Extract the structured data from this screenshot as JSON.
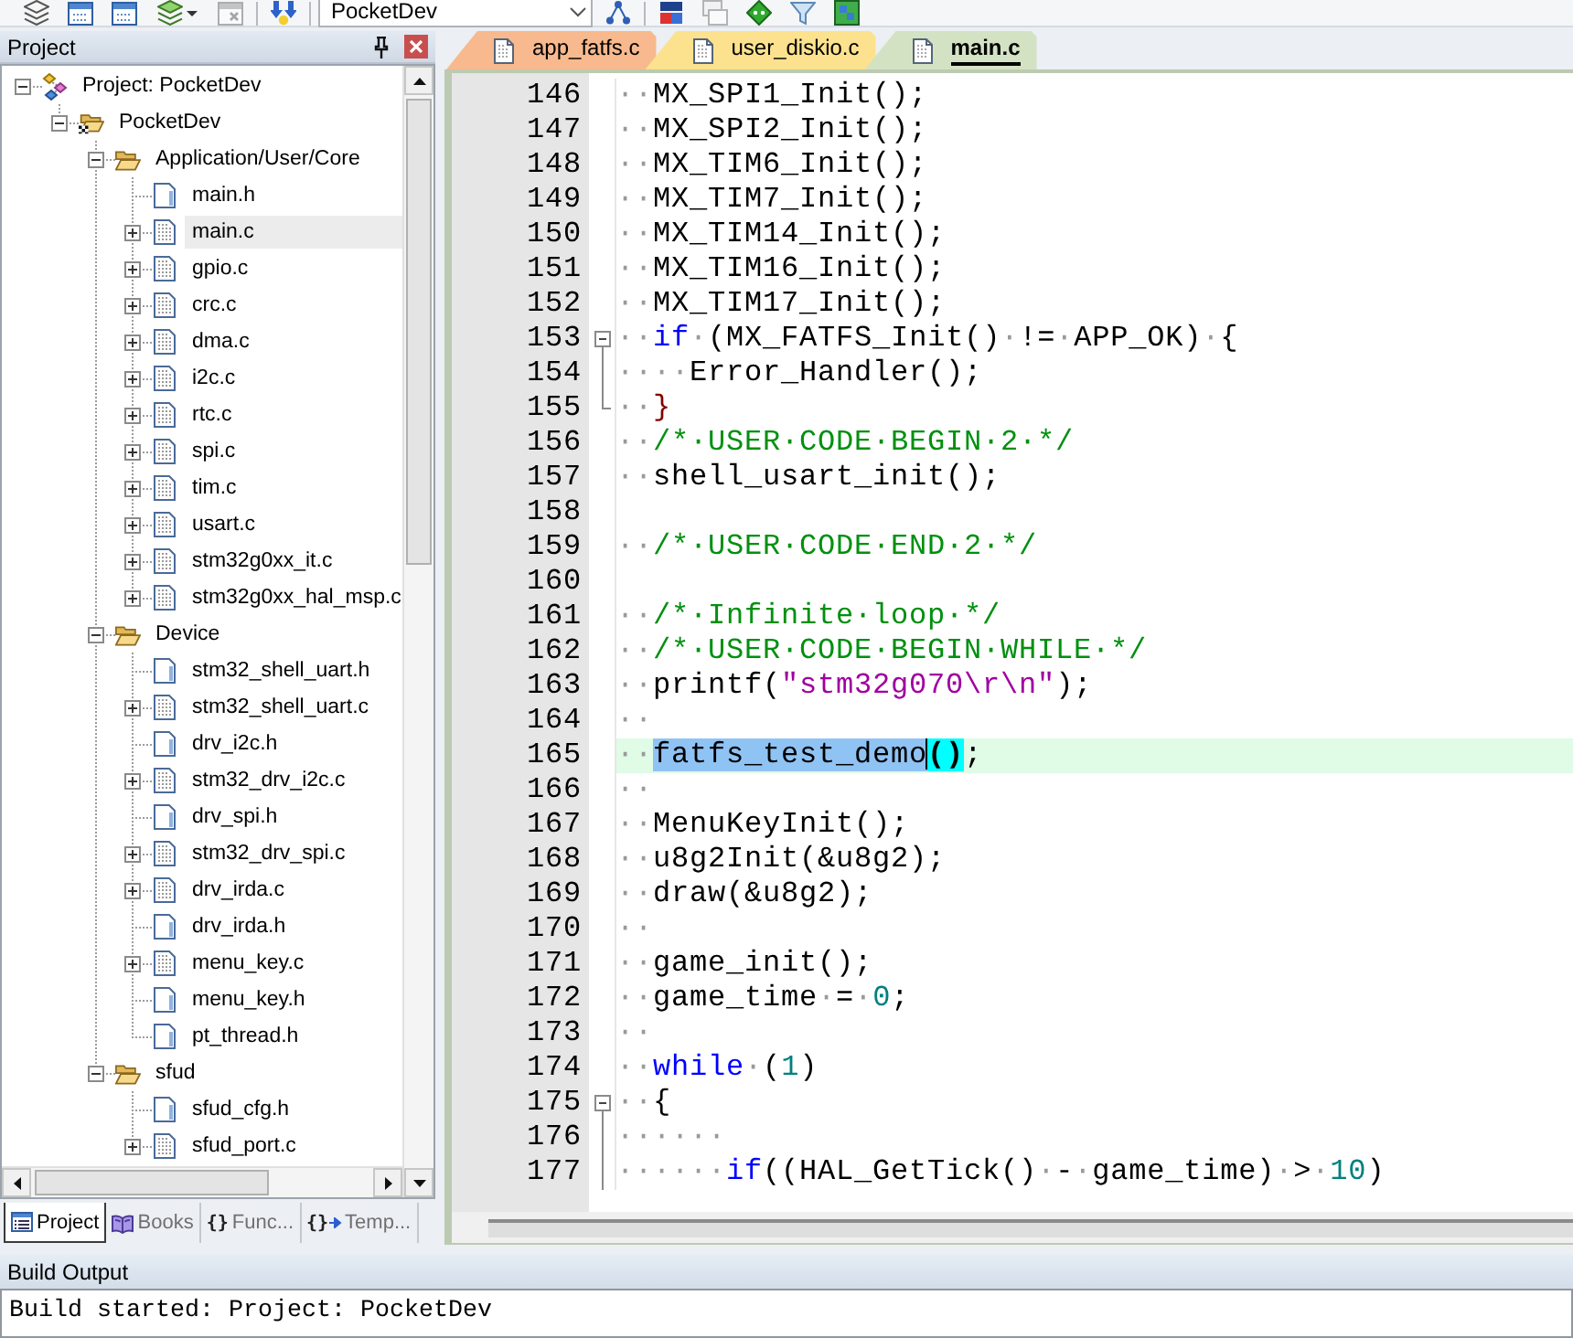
{
  "toolbar": {
    "items": [
      {
        "kind": "button",
        "disabled": false
      },
      {
        "kind": "button",
        "disabled": false
      },
      {
        "kind": "button",
        "disabled": false
      },
      {
        "kind": "dropdown_button",
        "disabled": false
      },
      {
        "kind": "button",
        "disabled": true
      },
      {
        "kind": "separator"
      },
      {
        "kind": "button",
        "disabled": false
      },
      {
        "kind": "separator"
      },
      {
        "kind": "select",
        "value": "PocketDev"
      },
      {
        "kind": "button",
        "disabled": false
      },
      {
        "kind": "separator"
      },
      {
        "kind": "button",
        "disabled": false
      },
      {
        "kind": "button",
        "disabled": true
      },
      {
        "kind": "button",
        "disabled": false
      },
      {
        "kind": "button",
        "disabled": false
      },
      {
        "kind": "button",
        "disabled": false
      }
    ]
  },
  "project_panel": {
    "title": "Project",
    "tree": [
      {
        "label": "Project: PocketDev",
        "kind": "project",
        "expanded": true,
        "selected": false,
        "children": [
          {
            "label": "PocketDev",
            "kind": "target",
            "expanded": true,
            "selected": false,
            "children": [
              {
                "label": "Application/User/Core",
                "kind": "group",
                "expanded": true,
                "selected": false,
                "children": [
                  {
                    "label": "main.h",
                    "kind": "header",
                    "selected": false
                  },
                  {
                    "label": "main.c",
                    "kind": "source",
                    "expanded": false,
                    "selected": true
                  },
                  {
                    "label": "gpio.c",
                    "kind": "source",
                    "expanded": false,
                    "selected": false
                  },
                  {
                    "label": "crc.c",
                    "kind": "source",
                    "expanded": false,
                    "selected": false
                  },
                  {
                    "label": "dma.c",
                    "kind": "source",
                    "expanded": false,
                    "selected": false
                  },
                  {
                    "label": "i2c.c",
                    "kind": "source",
                    "expanded": false,
                    "selected": false
                  },
                  {
                    "label": "rtc.c",
                    "kind": "source",
                    "expanded": false,
                    "selected": false
                  },
                  {
                    "label": "spi.c",
                    "kind": "source",
                    "expanded": false,
                    "selected": false
                  },
                  {
                    "label": "tim.c",
                    "kind": "source",
                    "expanded": false,
                    "selected": false
                  },
                  {
                    "label": "usart.c",
                    "kind": "source",
                    "expanded": false,
                    "selected": false
                  },
                  {
                    "label": "stm32g0xx_it.c",
                    "kind": "source",
                    "expanded": false,
                    "selected": false
                  },
                  {
                    "label": "stm32g0xx_hal_msp.c",
                    "kind": "source",
                    "expanded": false,
                    "selected": false
                  }
                ]
              },
              {
                "label": "Device",
                "kind": "group",
                "expanded": true,
                "selected": false,
                "children": [
                  {
                    "label": "stm32_shell_uart.h",
                    "kind": "header",
                    "selected": false
                  },
                  {
                    "label": "stm32_shell_uart.c",
                    "kind": "source",
                    "expanded": false,
                    "selected": false
                  },
                  {
                    "label": "drv_i2c.h",
                    "kind": "header",
                    "selected": false
                  },
                  {
                    "label": "stm32_drv_i2c.c",
                    "kind": "source",
                    "expanded": false,
                    "selected": false
                  },
                  {
                    "label": "drv_spi.h",
                    "kind": "header",
                    "selected": false
                  },
                  {
                    "label": "stm32_drv_spi.c",
                    "kind": "source",
                    "expanded": false,
                    "selected": false
                  },
                  {
                    "label": "drv_irda.c",
                    "kind": "source",
                    "expanded": false,
                    "selected": false
                  },
                  {
                    "label": "drv_irda.h",
                    "kind": "header",
                    "selected": false
                  },
                  {
                    "label": "menu_key.c",
                    "kind": "source",
                    "expanded": false,
                    "selected": false
                  },
                  {
                    "label": "menu_key.h",
                    "kind": "header",
                    "selected": false
                  },
                  {
                    "label": "pt_thread.h",
                    "kind": "header",
                    "selected": false
                  }
                ]
              },
              {
                "label": "sfud",
                "kind": "group",
                "expanded": true,
                "selected": false,
                "children": [
                  {
                    "label": "sfud_cfg.h",
                    "kind": "header",
                    "selected": false
                  },
                  {
                    "label": "sfud_port.c",
                    "kind": "source",
                    "expanded": false,
                    "selected": false
                  }
                ]
              }
            ]
          }
        ]
      }
    ],
    "tabs": [
      {
        "label": "Project",
        "kind": "project",
        "selected": true
      },
      {
        "label": "Books",
        "kind": "books",
        "selected": false
      },
      {
        "label": "Func...",
        "kind": "functions",
        "glyph": "{}",
        "selected": false
      },
      {
        "label": "Temp...",
        "kind": "templates",
        "glyph": "{}",
        "selected": false
      }
    ]
  },
  "editor": {
    "tabs": [
      {
        "label": "app_fatfs.c",
        "color": "#f7b98d",
        "selected": false
      },
      {
        "label": "user_diskio.c",
        "color": "#fce28e",
        "selected": false
      },
      {
        "label": "main.c",
        "color": "#d4e2c4",
        "selected": true
      }
    ],
    "code_lines": [
      {
        "number": "146",
        "kind": "line",
        "current": false,
        "segments": [
          {
            "kind": "ws",
            "text": "··"
          },
          {
            "kind": "plain",
            "text": "MX_SPI1_Init();"
          }
        ]
      },
      {
        "number": "147",
        "kind": "line",
        "current": false,
        "segments": [
          {
            "kind": "ws",
            "text": "··"
          },
          {
            "kind": "plain",
            "text": "MX_SPI2_Init();"
          }
        ]
      },
      {
        "number": "148",
        "kind": "line",
        "current": false,
        "segments": [
          {
            "kind": "ws",
            "text": "··"
          },
          {
            "kind": "plain",
            "text": "MX_TIM6_Init();"
          }
        ]
      },
      {
        "number": "149",
        "kind": "line",
        "current": false,
        "segments": [
          {
            "kind": "ws",
            "text": "··"
          },
          {
            "kind": "plain",
            "text": "MX_TIM7_Init();"
          }
        ]
      },
      {
        "number": "150",
        "kind": "line",
        "current": false,
        "segments": [
          {
            "kind": "ws",
            "text": "··"
          },
          {
            "kind": "plain",
            "text": "MX_TIM14_Init();"
          }
        ]
      },
      {
        "number": "151",
        "kind": "line",
        "current": false,
        "segments": [
          {
            "kind": "ws",
            "text": "··"
          },
          {
            "kind": "plain",
            "text": "MX_TIM16_Init();"
          }
        ]
      },
      {
        "number": "152",
        "kind": "line",
        "current": false,
        "segments": [
          {
            "kind": "ws",
            "text": "··"
          },
          {
            "kind": "plain",
            "text": "MX_TIM17_Init();"
          }
        ]
      },
      {
        "number": "153",
        "kind": "fold_start",
        "current": false,
        "segments": [
          {
            "kind": "ws",
            "text": "··"
          },
          {
            "kind": "keyword",
            "text": "if"
          },
          {
            "kind": "ws",
            "text": "·"
          },
          {
            "kind": "plain",
            "text": "(MX_FATFS_Init()"
          },
          {
            "kind": "ws",
            "text": "·"
          },
          {
            "kind": "plain",
            "text": "!="
          },
          {
            "kind": "ws",
            "text": "·"
          },
          {
            "kind": "plain",
            "text": "APP_OK)"
          },
          {
            "kind": "ws",
            "text": "·"
          },
          {
            "kind": "plain",
            "text": "{"
          }
        ]
      },
      {
        "number": "154",
        "kind": "fold_body",
        "current": false,
        "segments": [
          {
            "kind": "ws",
            "text": "····"
          },
          {
            "kind": "plain",
            "text": "Error_Handler();"
          }
        ]
      },
      {
        "number": "155",
        "kind": "fold_end",
        "current": false,
        "segments": [
          {
            "kind": "ws",
            "text": "··"
          },
          {
            "kind": "brace",
            "text": "}"
          }
        ]
      },
      {
        "number": "156",
        "kind": "line",
        "current": false,
        "segments": [
          {
            "kind": "ws",
            "text": "··"
          },
          {
            "kind": "comment",
            "text": "/*·USER·CODE·BEGIN·2·*/"
          }
        ]
      },
      {
        "number": "157",
        "kind": "line",
        "current": false,
        "segments": [
          {
            "kind": "ws",
            "text": "··"
          },
          {
            "kind": "plain",
            "text": "shell_usart_init();"
          }
        ]
      },
      {
        "number": "158",
        "kind": "line",
        "current": false
      },
      {
        "number": "159",
        "kind": "line",
        "current": false,
        "segments": [
          {
            "kind": "ws",
            "text": "··"
          },
          {
            "kind": "comment",
            "text": "/*·USER·CODE·END·2·*/"
          }
        ]
      },
      {
        "number": "160",
        "kind": "line",
        "current": false
      },
      {
        "number": "161",
        "kind": "line",
        "current": false,
        "segments": [
          {
            "kind": "ws",
            "text": "··"
          },
          {
            "kind": "comment",
            "text": "/*·Infinite·loop·*/"
          }
        ]
      },
      {
        "number": "162",
        "kind": "line",
        "current": false,
        "segments": [
          {
            "kind": "ws",
            "text": "··"
          },
          {
            "kind": "comment",
            "text": "/*·USER·CODE·BEGIN·WHILE·*/"
          }
        ]
      },
      {
        "number": "163",
        "kind": "line",
        "current": false,
        "segments": [
          {
            "kind": "ws",
            "text": "··"
          },
          {
            "kind": "plain",
            "text": "printf("
          },
          {
            "kind": "string",
            "text": "\"stm32g070\\r\\n\""
          },
          {
            "kind": "plain",
            "text": ");"
          }
        ]
      },
      {
        "number": "164",
        "kind": "line",
        "current": false,
        "segments": [
          {
            "kind": "ws",
            "text": "··"
          }
        ]
      },
      {
        "number": "165",
        "kind": "line",
        "current": true,
        "segments": [
          {
            "kind": "ws",
            "text": "··"
          },
          {
            "kind": "selection",
            "text": "fatfs_test_demo",
            "caret": true
          },
          {
            "kind": "brace_match",
            "text": "()"
          },
          {
            "kind": "plain",
            "text": ";"
          }
        ]
      },
      {
        "number": "166",
        "kind": "line",
        "current": false,
        "segments": [
          {
            "kind": "ws",
            "text": "··"
          }
        ]
      },
      {
        "number": "167",
        "kind": "line",
        "current": false,
        "segments": [
          {
            "kind": "ws",
            "text": "··"
          },
          {
            "kind": "plain",
            "text": "MenuKeyInit();"
          }
        ]
      },
      {
        "number": "168",
        "kind": "line",
        "current": false,
        "segments": [
          {
            "kind": "ws",
            "text": "··"
          },
          {
            "kind": "plain",
            "text": "u8g2Init(&u8g2);"
          }
        ]
      },
      {
        "number": "169",
        "kind": "line",
        "current": false,
        "segments": [
          {
            "kind": "ws",
            "text": "··"
          },
          {
            "kind": "plain",
            "text": "draw(&u8g2);"
          }
        ]
      },
      {
        "number": "170",
        "kind": "line",
        "current": false,
        "segments": [
          {
            "kind": "ws",
            "text": "··"
          }
        ]
      },
      {
        "number": "171",
        "kind": "line",
        "current": false,
        "segments": [
          {
            "kind": "ws",
            "text": "··"
          },
          {
            "kind": "plain",
            "text": "game_init();"
          }
        ]
      },
      {
        "number": "172",
        "kind": "line",
        "current": false,
        "segments": [
          {
            "kind": "ws",
            "text": "··"
          },
          {
            "kind": "plain",
            "text": "game_time"
          },
          {
            "kind": "ws",
            "text": "·"
          },
          {
            "kind": "plain",
            "text": "="
          },
          {
            "kind": "ws",
            "text": "·"
          },
          {
            "kind": "number",
            "text": "0"
          },
          {
            "kind": "plain",
            "text": ";"
          }
        ]
      },
      {
        "number": "173",
        "kind": "line",
        "current": false,
        "segments": [
          {
            "kind": "ws",
            "text": "··"
          }
        ]
      },
      {
        "number": "174",
        "kind": "line",
        "current": false,
        "segments": [
          {
            "kind": "ws",
            "text": "··"
          },
          {
            "kind": "keyword",
            "text": "while"
          },
          {
            "kind": "ws",
            "text": "·"
          },
          {
            "kind": "plain",
            "text": "("
          },
          {
            "kind": "number",
            "text": "1"
          },
          {
            "kind": "plain",
            "text": ")"
          }
        ]
      },
      {
        "number": "175",
        "kind": "fold_start",
        "current": false,
        "segments": [
          {
            "kind": "ws",
            "text": "··"
          },
          {
            "kind": "plain",
            "text": "{"
          }
        ]
      },
      {
        "number": "176",
        "kind": "fold_body",
        "current": false,
        "segments": [
          {
            "kind": "ws",
            "text": "······"
          }
        ]
      },
      {
        "number": "177",
        "kind": "fold_body",
        "current": false,
        "segments": [
          {
            "kind": "ws",
            "text": "······"
          },
          {
            "kind": "keyword",
            "text": "if"
          },
          {
            "kind": "plain",
            "text": "((HAL_GetTick()"
          },
          {
            "kind": "ws",
            "text": "·"
          },
          {
            "kind": "plain",
            "text": "-"
          },
          {
            "kind": "ws",
            "text": "·"
          },
          {
            "kind": "plain",
            "text": "game_time)"
          },
          {
            "kind": "ws",
            "text": "·"
          },
          {
            "kind": "plain",
            "text": ">"
          },
          {
            "kind": "ws",
            "text": "·"
          },
          {
            "kind": "number",
            "text": "10"
          },
          {
            "kind": "plain",
            "text": ")"
          }
        ]
      }
    ]
  },
  "build_output": {
    "title": "Build Output",
    "lines": [
      "Build started: Project: PocketDev"
    ]
  }
}
